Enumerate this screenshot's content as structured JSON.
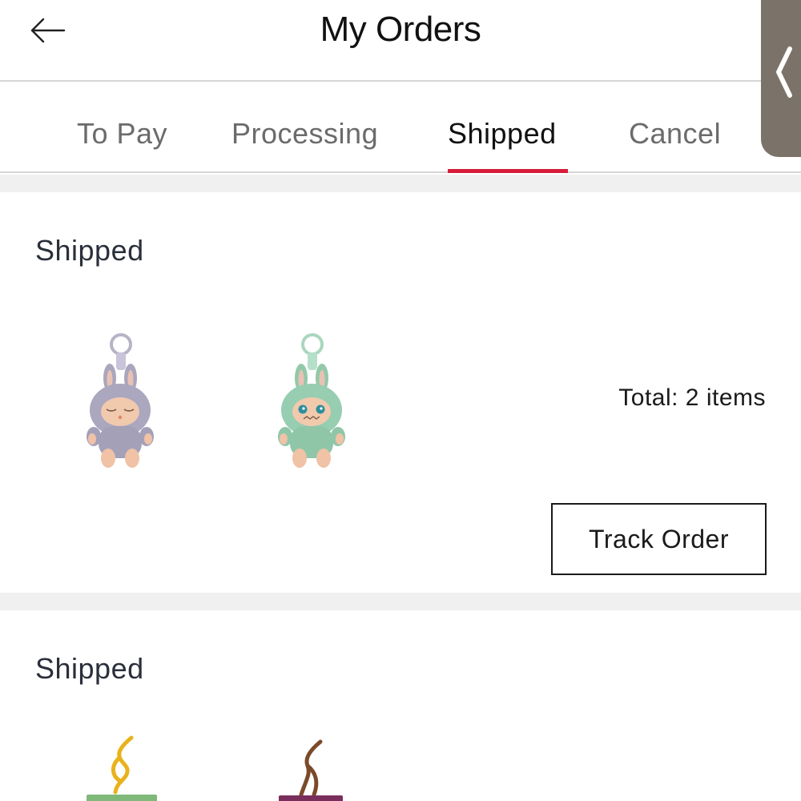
{
  "header": {
    "title": "My Orders",
    "back_icon": "arrow-left-icon"
  },
  "tabs": [
    {
      "label": "To Pay",
      "active": false
    },
    {
      "label": "Processing",
      "active": false
    },
    {
      "label": "Shipped",
      "active": true
    },
    {
      "label": "Cancel",
      "active": false
    }
  ],
  "side_handle": {
    "icon": "chevron-left-icon"
  },
  "colors": {
    "accent": "#d61d3a",
    "tab_inactive": "#6b6b6b",
    "handle_bg": "#7b726a"
  },
  "orders": [
    {
      "status": "Shipped",
      "items": [
        {
          "icon": "plush-keychain-lavender-icon"
        },
        {
          "icon": "plush-keychain-mint-icon"
        }
      ],
      "total": "Total: 2 items",
      "action_label": "Track Order"
    },
    {
      "status": "Shipped",
      "items": [
        {
          "icon": "keychain-green-icon"
        },
        {
          "icon": "keychain-purple-icon"
        }
      ]
    }
  ]
}
